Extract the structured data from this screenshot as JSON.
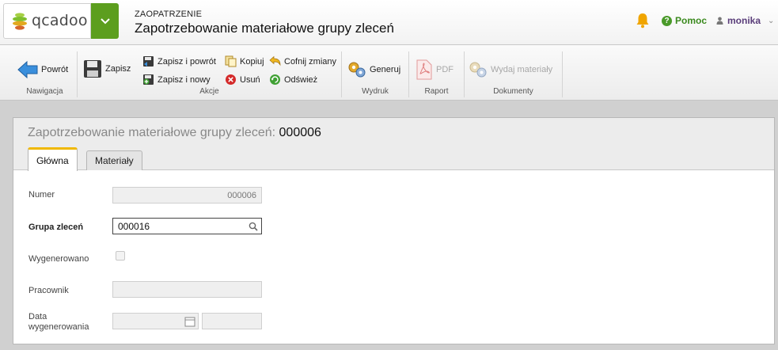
{
  "header": {
    "logo_text": "qcadoo",
    "section": "ZAOPATRZENIE",
    "title": "Zapotrzebowanie materiałowe grupy zleceń",
    "help_label": "Pomoc",
    "user_name": "monika"
  },
  "toolbar": {
    "groups": {
      "nav": "Nawigacja",
      "actions": "Akcje",
      "print": "Wydruk",
      "report": "Raport",
      "documents": "Dokumenty"
    },
    "back": "Powrót",
    "save": "Zapisz",
    "save_back": "Zapisz i powrót",
    "save_new": "Zapisz i nowy",
    "copy": "Kopiuj",
    "delete": "Usuń",
    "undo": "Cofnij zmiany",
    "refresh": "Odśwież",
    "generate": "Generuj",
    "pdf": "PDF",
    "issue": "Wydaj materiały"
  },
  "form": {
    "title_prefix": "Zapotrzebowanie materiałowe grupy zleceń:",
    "title_number": "000006",
    "tabs": [
      "Główna",
      "Materiały"
    ],
    "number_label": "Numer",
    "number_value": "000006",
    "group_label": "Grupa zleceń",
    "group_value": "000016",
    "generated_label": "Wygenerowano",
    "worker_label": "Pracownik",
    "worker_value": "",
    "date_label_line1": "Data",
    "date_label_line2": "wygenerowania",
    "date_value": "",
    "time_value": ""
  },
  "colors": {
    "brand_green": "#5c9e1e",
    "tab_accent": "#f0b800",
    "user_purple": "#5a3d7a"
  }
}
